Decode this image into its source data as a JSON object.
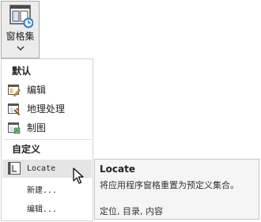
{
  "ribbon": {
    "pane_sets_label": "窗格集",
    "pane_sets_icon": "pane-sets-icon",
    "dropdown_icon": "chevron-down-icon"
  },
  "menu": {
    "default_header": "默认",
    "default_items": [
      {
        "label": "编辑",
        "icon": "edit-pane-icon"
      },
      {
        "label": "地理处理",
        "icon": "geoprocessing-pane-icon"
      },
      {
        "label": "制图",
        "icon": "mapping-pane-icon"
      }
    ],
    "custom_header": "自定义",
    "custom_items": [
      {
        "label": "Locate",
        "icon": "locate-pane-icon",
        "hovered": true
      },
      {
        "label": "新建..."
      },
      {
        "label": "编辑..."
      }
    ]
  },
  "tooltip": {
    "title": "Locate",
    "description": "将应用程序窗格重置为预定义集合。",
    "tags": "定位, 目录, 内容"
  },
  "colors": {
    "accent_blue": "#2a7fd4",
    "hover_bg": "#e5e5e5",
    "tooltip_bg": "#f5f5f5"
  }
}
